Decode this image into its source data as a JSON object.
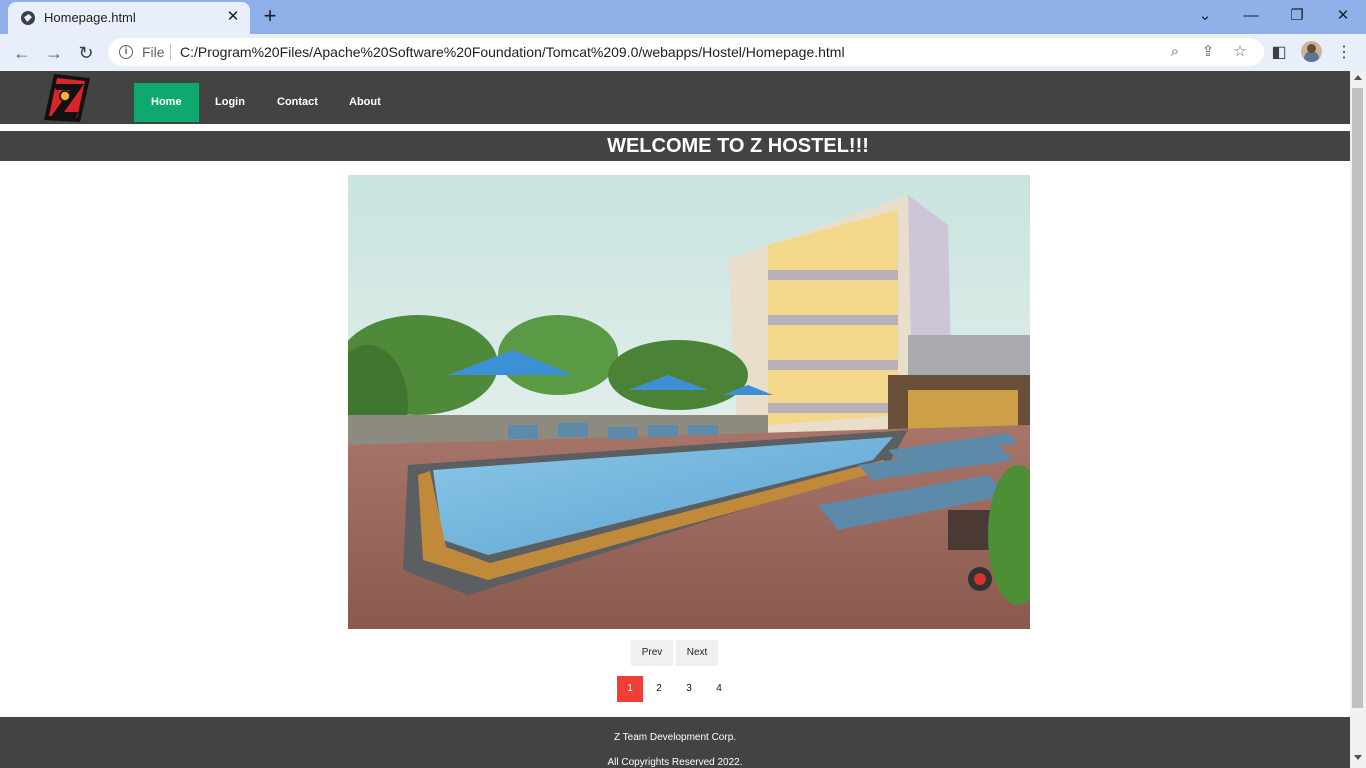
{
  "browser": {
    "tab_title": "Homepage.html",
    "scheme_label": "File",
    "url": "C:/Program%20Files/Apache%20Software%20Foundation/Tomcat%209.0/webapps/Hostel/Homepage.html",
    "icons": {
      "tab_favicon": "globe-icon",
      "close": "close-icon",
      "new_tab": "plus-icon",
      "back": "back-arrow-icon",
      "forward": "forward-arrow-icon",
      "reload": "reload-icon",
      "info": "info-icon",
      "zoom": "zoom-icon",
      "share": "share-icon",
      "bookmark": "star-icon",
      "side_panel": "side-panel-icon",
      "menu": "kebab-menu-icon"
    }
  },
  "site": {
    "nav": {
      "items": [
        {
          "label": "Home",
          "active": true
        },
        {
          "label": "Login",
          "active": false
        },
        {
          "label": "Contact",
          "active": false
        },
        {
          "label": "About",
          "active": false
        }
      ]
    },
    "banner_title": "WELCOME TO Z HOSTEL!!!",
    "slider": {
      "prev_label": "Prev",
      "next_label": "Next",
      "pages": [
        "1",
        "2",
        "3",
        "4"
      ],
      "current_page": "1"
    },
    "footer": {
      "company": "Z Team Development Corp.",
      "copyright": "All Copyrights Reserved 2022."
    },
    "colors": {
      "nav_bg": "#434343",
      "active_nav": "#0fa86f",
      "active_dot": "#ef3d38"
    }
  }
}
